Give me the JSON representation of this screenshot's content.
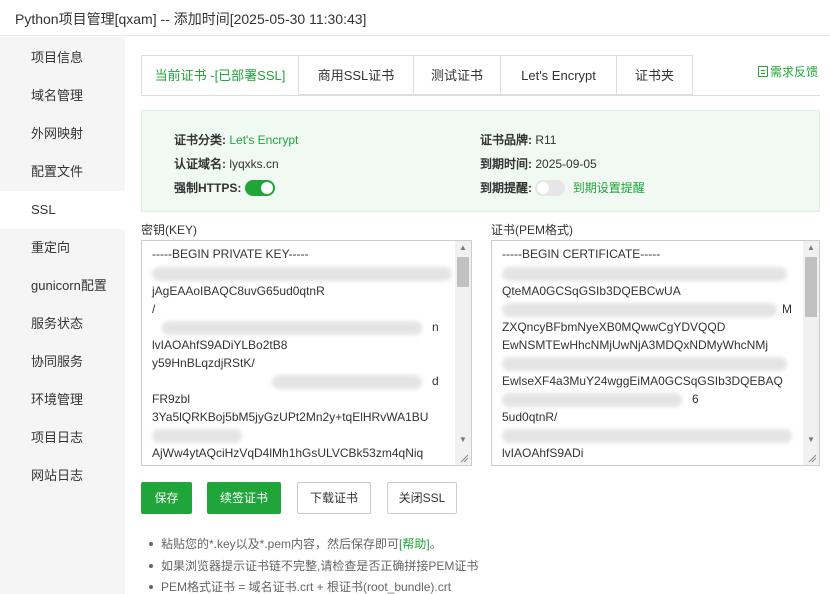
{
  "window": {
    "title": "Python项目管理[qxam] -- 添加时间[2025-05-30 11:30:43]"
  },
  "sidebar": {
    "items": [
      {
        "label": "项目信息"
      },
      {
        "label": "域名管理"
      },
      {
        "label": "外网映射"
      },
      {
        "label": "配置文件"
      },
      {
        "label": "SSL",
        "active": true
      },
      {
        "label": "重定向"
      },
      {
        "label": "gunicorn配置"
      },
      {
        "label": "服务状态"
      },
      {
        "label": "协同服务"
      },
      {
        "label": "环境管理"
      },
      {
        "label": "项目日志"
      },
      {
        "label": "网站日志"
      }
    ]
  },
  "tabs": [
    {
      "label": "当前证书 -[已部署SSL]",
      "active": true
    },
    {
      "label": "商用SSL证书"
    },
    {
      "label": "测试证书"
    },
    {
      "label": "Let's Encrypt"
    },
    {
      "label": "证书夹"
    }
  ],
  "feedback": {
    "label": "需求反馈",
    "icon": "feedback-icon"
  },
  "cert_info": {
    "type_label": "证书分类:",
    "type_value": "Let's Encrypt",
    "brand_label": "证书品牌:",
    "brand_value": "R11",
    "domain_label": "认证域名:",
    "domain_value": "lyqxks.cn",
    "expire_label": "到期时间:",
    "expire_value": "2025-09-05",
    "https_label": "强制HTTPS:",
    "https_on": true,
    "remind_label": "到期提醒:",
    "remind_on": false,
    "remind_link": "到期设置提醒"
  },
  "key_area": {
    "label": "密钥(KEY)",
    "lines": [
      "-----BEGIN PRIVATE KEY-----",
      "jAgEAAoIBAQC8uvG65ud0qtnR",
      "/",
      "n",
      "lvIAOAhfS9ADiYLBo2tB8",
      "y59HnBLqzdjRStK/",
      "d",
      "FR9zbl",
      "3Ya5lQRKBoj5bM5jyGzUPt2Mn2y+tqElHRvWA1BU",
      "AjWw4ytAQciHzVqD4lMh1hGsULVCBk53zm4qNiq"
    ]
  },
  "cert_area": {
    "label": "证书(PEM格式)",
    "lines": [
      "-----BEGIN CERTIFICATE-----",
      "QteMA0GCSqGSIb3DQEBCwUA",
      "M",
      "ZXQncyBFbmNyeXB0MQwwCgYDVQQD",
      "EwNSMTEwHhcNMjUwNjA3MDQxNDMyWhcNMj",
      "EwlseXF4a3MuY24wggEiMA0GCSqGSIb3DQEBAQ",
      "6",
      "5ud0qtnR/",
      "lvIAOAhfS9ADi"
    ]
  },
  "buttons": {
    "save": "保存",
    "renew": "续签证书",
    "download": "下载证书",
    "close_ssl": "关闭SSL"
  },
  "tips": {
    "tip1_text": "粘贴您的*.key以及*.pem内容，然后保存即可",
    "tip1_link": "[帮助]",
    "tip1_end": "。",
    "tip2": "如果浏览器提示证书链不完整,请检查是否正确拼接PEM证书",
    "tip3": "PEM格式证书 = 域名证书.crt + 根证书(root_bundle).crt"
  },
  "colors": {
    "accent": "#20a53a",
    "info_bg": "#f1f9f3",
    "sidebar_bg": "#f5f5f5"
  }
}
